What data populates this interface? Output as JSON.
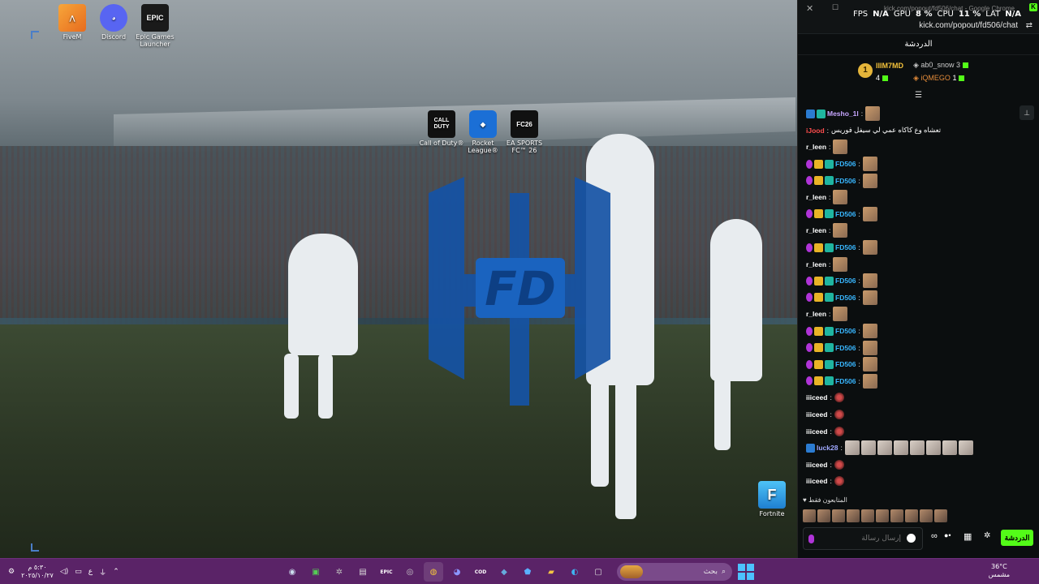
{
  "desktop": {
    "icons_top": [
      {
        "label": "FiveM",
        "icon": "fivem-icon"
      },
      {
        "label": "Discord",
        "icon": "discord-icon"
      },
      {
        "label": "Epic Games Launcher",
        "icon": "epic-games-icon",
        "glyph": "EPIC"
      }
    ],
    "icons_center": [
      {
        "label": "Call of Duty®",
        "icon": "call-of-duty-icon",
        "glyph": "CALL DUTY"
      },
      {
        "label": "Rocket League®",
        "icon": "rocket-league-icon"
      },
      {
        "label": "EA SPORTS FC™ 26",
        "icon": "ea-fc-icon",
        "glyph": "FC26"
      }
    ],
    "icon_bottom_right": {
      "label": "Fortnite",
      "icon": "fortnite-icon",
      "glyph": "F"
    },
    "logo_text": "FD"
  },
  "browser": {
    "window_title": "kick.com/popout/fd506/chat - Google Chrome",
    "address": "kick.com/popout/fd506/chat",
    "overlay": {
      "fps_label": "FPS",
      "fps_value": "N/A",
      "gpu_label": "GPU",
      "gpu_value": "8 %",
      "cpu_label": "CPU",
      "cpu_value": "11 %",
      "lat_label": "LAT",
      "lat_value": "N/A"
    },
    "close_glyph": "✕",
    "maximize_glyph": "☐"
  },
  "chat": {
    "title": "الدردشة",
    "leaderboard": {
      "first": {
        "rank": "1",
        "name": "lIIM7MD",
        "count": "4"
      },
      "second": {
        "name": "ab0_snow",
        "count": "3"
      },
      "third": {
        "name": "iQMEGO",
        "count": "1"
      }
    },
    "messages": [
      {
        "badges": [
          "vip",
          "sub"
        ],
        "user": "Mesho_1l",
        "color": "#c7a6ff",
        "emotes": 1,
        "text": ""
      },
      {
        "badges": [],
        "user": "iJood",
        "color": "#ff4d4d",
        "emotes": 0,
        "text": "تعشاه وع كاكاه عمي لي سيفل فوريس"
      },
      {
        "badges": [],
        "user": "r_leen",
        "color": "#ffffff",
        "emotes": 1,
        "text": ""
      },
      {
        "badges": [
          "mic",
          "crown",
          "sub"
        ],
        "user": "FD506",
        "color": "#38b6ff",
        "emotes": 1,
        "text": ""
      },
      {
        "badges": [
          "mic",
          "crown",
          "sub"
        ],
        "user": "FD506",
        "color": "#38b6ff",
        "emotes": 1,
        "text": ""
      },
      {
        "badges": [],
        "user": "r_leen",
        "color": "#ffffff",
        "emotes": 1,
        "text": ""
      },
      {
        "badges": [
          "mic",
          "crown",
          "sub"
        ],
        "user": "FD506",
        "color": "#38b6ff",
        "emotes": 1,
        "text": ""
      },
      {
        "badges": [],
        "user": "r_leen",
        "color": "#ffffff",
        "emotes": 1,
        "text": ""
      },
      {
        "badges": [
          "mic",
          "crown",
          "sub"
        ],
        "user": "FD506",
        "color": "#38b6ff",
        "emotes": 1,
        "text": ""
      },
      {
        "badges": [],
        "user": "r_leen",
        "color": "#ffffff",
        "emotes": 1,
        "text": ""
      },
      {
        "badges": [
          "mic",
          "crown",
          "sub"
        ],
        "user": "FD506",
        "color": "#38b6ff",
        "emotes": 1,
        "text": ""
      },
      {
        "badges": [
          "mic",
          "crown",
          "sub"
        ],
        "user": "FD506",
        "color": "#38b6ff",
        "emotes": 1,
        "text": ""
      },
      {
        "badges": [],
        "user": "r_leen",
        "color": "#ffffff",
        "emotes": 1,
        "text": ""
      },
      {
        "badges": [
          "mic",
          "crown",
          "sub"
        ],
        "user": "FD506",
        "color": "#38b6ff",
        "emotes": 1,
        "text": ""
      },
      {
        "badges": [
          "mic",
          "crown",
          "sub"
        ],
        "user": "FD506",
        "color": "#38b6ff",
        "emotes": 1,
        "text": ""
      },
      {
        "badges": [
          "mic",
          "crown",
          "sub"
        ],
        "user": "FD506",
        "color": "#38b6ff",
        "emotes": 1,
        "text": ""
      },
      {
        "badges": [
          "mic",
          "crown",
          "sub"
        ],
        "user": "FD506",
        "color": "#38b6ff",
        "emotes": 1,
        "text": ""
      },
      {
        "badges": [],
        "user": "iiiceed",
        "color": "#ffffff",
        "emotes": 1,
        "small": true,
        "text": ""
      },
      {
        "badges": [],
        "user": "iiiceed",
        "color": "#ffffff",
        "emotes": 1,
        "small": true,
        "text": ""
      },
      {
        "badges": [],
        "user": "iiiceed",
        "color": "#ffffff",
        "emotes": 1,
        "small": true,
        "text": ""
      },
      {
        "badges": [
          "vip"
        ],
        "user": "luck28",
        "color": "#9fa8ff",
        "emotes": 8,
        "grey": true,
        "text": ""
      },
      {
        "badges": [],
        "user": "iiiceed",
        "color": "#ffffff",
        "emotes": 1,
        "small": true,
        "text": ""
      },
      {
        "badges": [],
        "user": "iiiceed",
        "color": "#ffffff",
        "emotes": 1,
        "small": true,
        "text": ""
      }
    ],
    "viewers_label": "المتابعون فقط",
    "composer_placeholder": "إرسال رسالة",
    "send_label": "الدردشة"
  },
  "taskbar": {
    "clock_time": "٥:٣٠ م",
    "clock_date": "٢٠٢٥/١٠/٢٧",
    "lang": "ع",
    "search_placeholder": "بحث",
    "weather_temp": "36°C",
    "weather_desc": "مشمس",
    "apps": [
      "steam-icon",
      "xbox-icon",
      "settings-icon",
      "store-icon",
      "epic-taskbar-icon",
      "obs-icon",
      "chrome-icon",
      "discord-taskbar-icon",
      "cod-taskbar-icon",
      "tag-icon",
      "rocket-taskbar-icon",
      "file-explorer-icon",
      "edge-icon",
      "window-icon"
    ]
  }
}
